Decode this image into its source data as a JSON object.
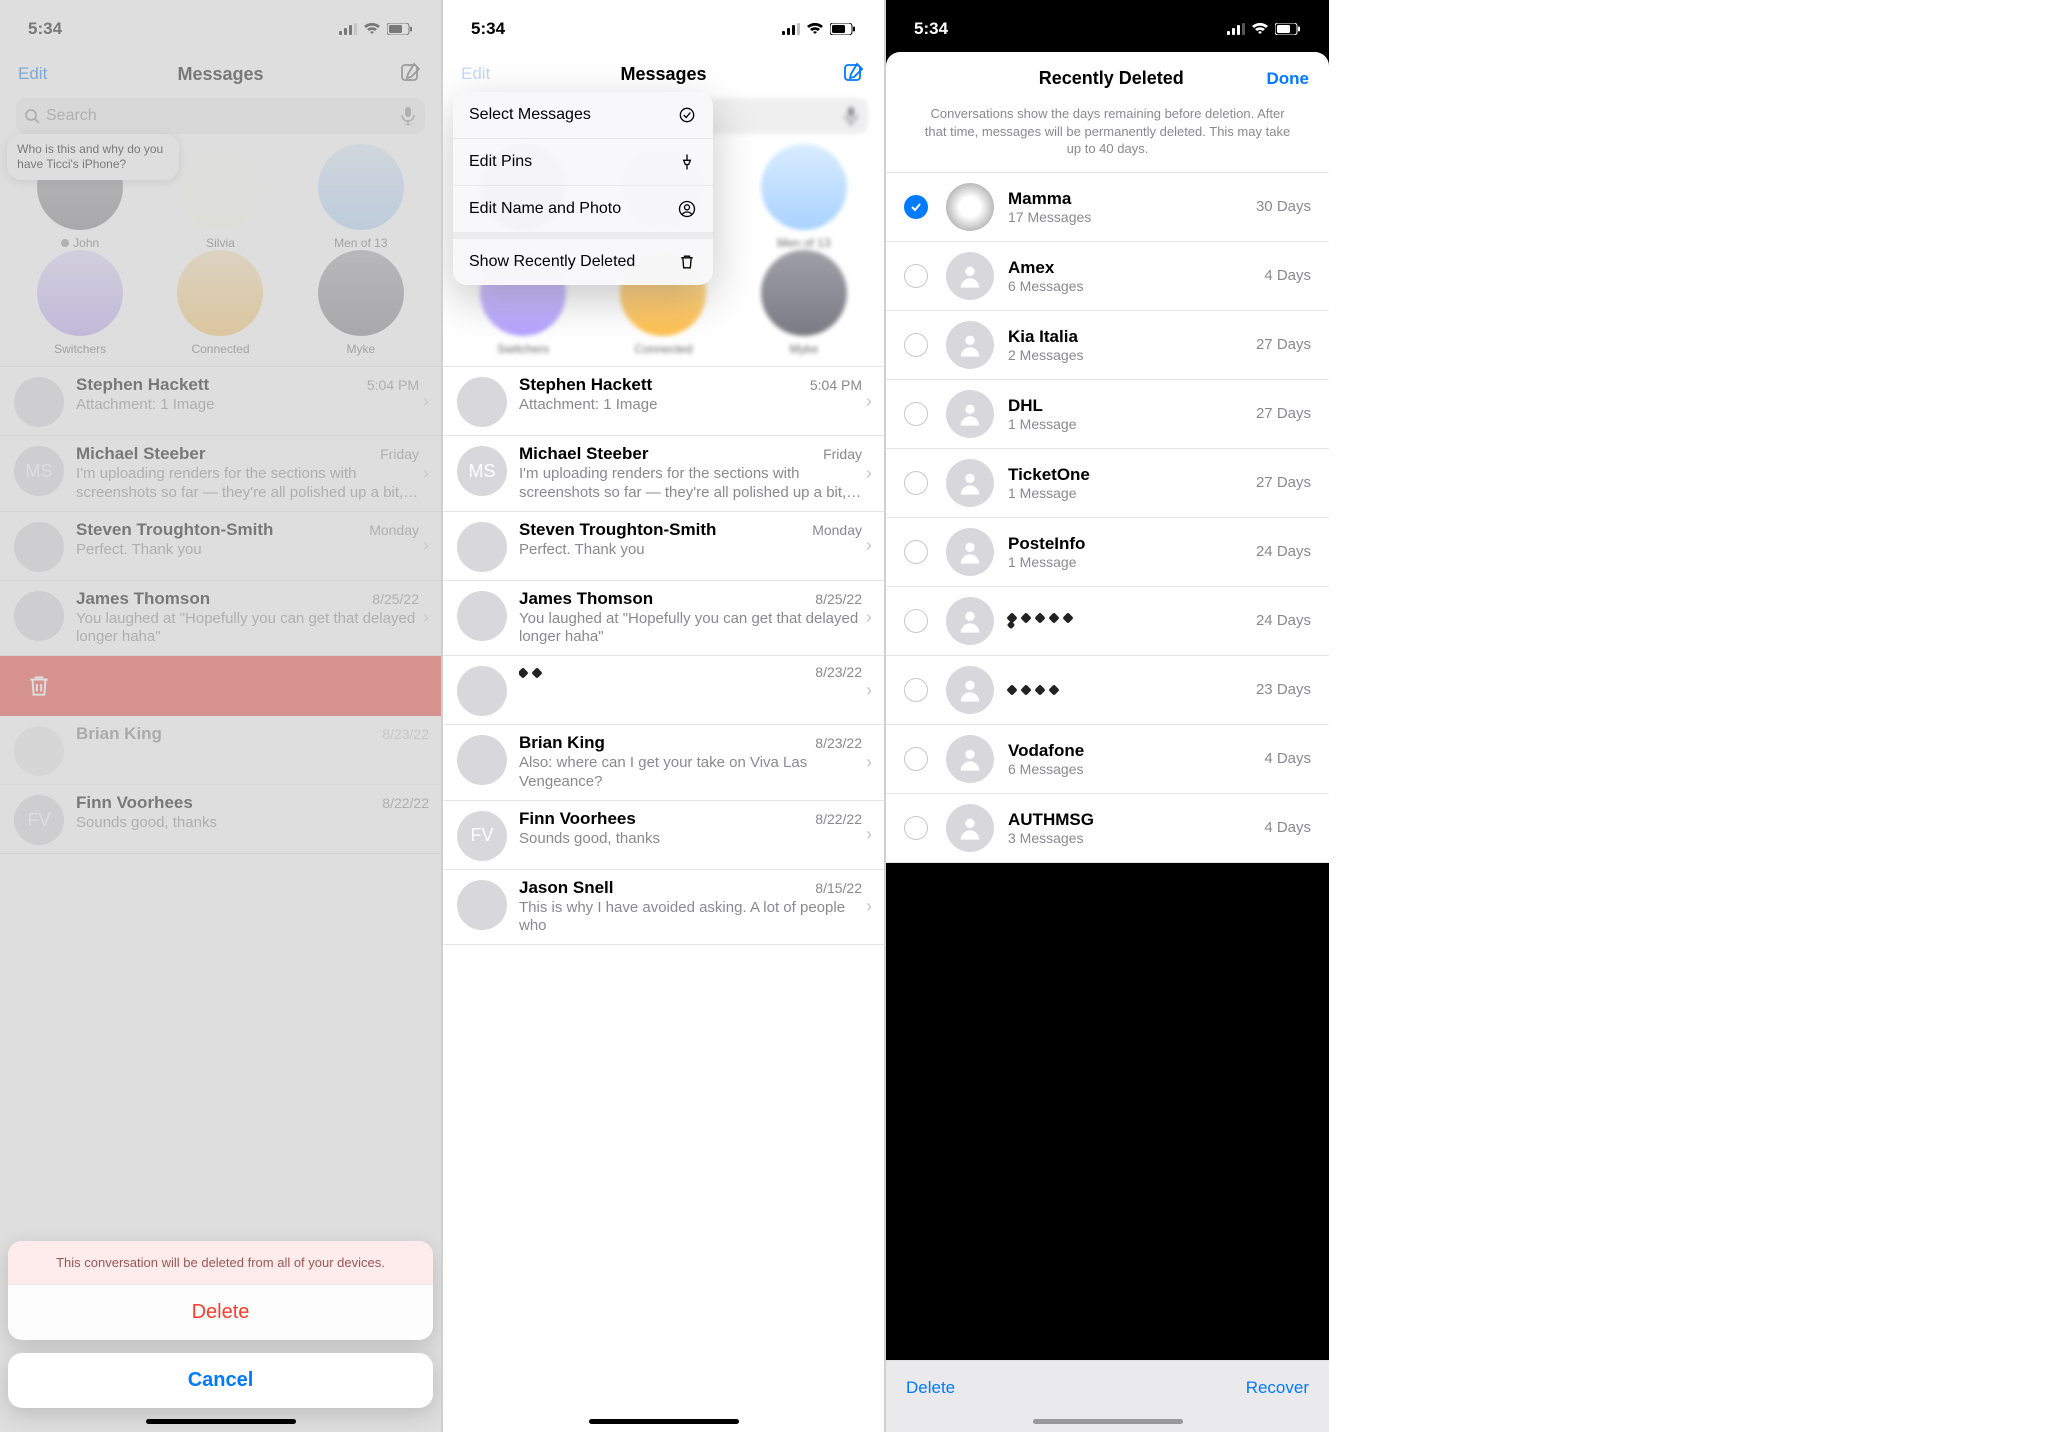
{
  "status": {
    "time": "5:34"
  },
  "panel1": {
    "nav": {
      "edit": "Edit",
      "title": "Messages"
    },
    "search": {
      "placeholder": "Search"
    },
    "pin_bubble": "Who is this and why do you have Ticci's iPhone?",
    "pins": [
      {
        "label": "John",
        "has_dot": true
      },
      {
        "label": "Silvia"
      },
      {
        "label": "Men of 13"
      },
      {
        "label": "Switchers"
      },
      {
        "label": "Connected"
      },
      {
        "label": "Myke"
      }
    ],
    "convs": [
      {
        "name": "Stephen Hackett",
        "time": "5:04 PM",
        "preview": "Attachment: 1 Image",
        "avatar": "av-yellow"
      },
      {
        "name": "Michael Steeber",
        "time": "Friday",
        "preview": "I'm uploading renders for the sections with screenshots so far — they're all polished up a bit, th…",
        "initials": "MS",
        "avatar": "av-ms"
      },
      {
        "name": "Steven Troughton-Smith",
        "time": "Monday",
        "preview": "Perfect. Thank you",
        "avatar": "av-person"
      },
      {
        "name": "James Thomson",
        "time": "8/25/22",
        "preview": "You laughed at \"Hopefully you can get that delayed longer haha\"",
        "avatar": "av-person"
      }
    ],
    "sheet": {
      "msg": "This conversation will be deleted from all of your devices.",
      "delete": "Delete",
      "cancel": "Cancel"
    },
    "below": [
      {
        "name": "Brian King",
        "time": "8/23/22",
        "preview": ""
      },
      {
        "name": "Finn Voorhees",
        "time": "8/22/22",
        "preview": "Sounds good, thanks",
        "initials": "FV"
      }
    ]
  },
  "panel2": {
    "nav": {
      "edit": "Edit",
      "title": "Messages"
    },
    "menu": {
      "select": "Select Messages",
      "pins": "Edit Pins",
      "name": "Edit Name and Photo",
      "deleted": "Show Recently Deleted"
    },
    "pins_labels": {
      "men": "Men of 13",
      "switchers": "Switchers",
      "connected": "Connected",
      "myke": "Myke"
    },
    "convs": [
      {
        "name": "Stephen Hackett",
        "time": "5:04 PM",
        "preview": "Attachment: 1 Image",
        "avatar": "av-yellow"
      },
      {
        "name": "Michael Steeber",
        "time": "Friday",
        "preview": "I'm uploading renders for the sections with screenshots so far — they're all polished up a bit, th…",
        "initials": "MS",
        "avatar": "av-ms"
      },
      {
        "name": "Steven Troughton-Smith",
        "time": "Monday",
        "preview": "Perfect. Thank you",
        "avatar": "av-person"
      },
      {
        "name": "James Thomson",
        "time": "8/25/22",
        "preview": "You laughed at \"Hopefully you can get that delayed longer haha\"",
        "avatar": "av-person"
      },
      {
        "name": "",
        "time": "8/23/22",
        "preview": "",
        "avatar": "av-blue",
        "masked": true
      },
      {
        "name": "Brian King",
        "time": "8/23/22",
        "preview": "Also: where can I get your take on Viva Las Vengeance?",
        "avatar": "av-person"
      },
      {
        "name": "Finn Voorhees",
        "time": "8/22/22",
        "preview": "Sounds good, thanks",
        "initials": "FV",
        "avatar": "av-ms"
      },
      {
        "name": "Jason Snell",
        "time": "8/15/22",
        "preview": "This is why I have avoided asking. A lot of people who",
        "avatar": "av-person"
      }
    ]
  },
  "panel3": {
    "title": "Recently Deleted",
    "done": "Done",
    "note": "Conversations show the days remaining before deletion. After that time, messages will be permanently deleted. This may take up to 40 days.",
    "items": [
      {
        "name": "Mamma",
        "sub": "17 Messages",
        "days": "30 Days",
        "checked": true,
        "avatar": "photo"
      },
      {
        "name": "Amex",
        "sub": "6 Messages",
        "days": "4 Days"
      },
      {
        "name": "Kia Italia",
        "sub": "2 Messages",
        "days": "27 Days"
      },
      {
        "name": "DHL",
        "sub": "1 Message",
        "days": "27 Days"
      },
      {
        "name": "TicketOne",
        "sub": "1 Message",
        "days": "27 Days"
      },
      {
        "name": "PosteInfo",
        "sub": "1 Message",
        "days": "24 Days"
      },
      {
        "name": "",
        "sub": "",
        "days": "24 Days",
        "masked": true
      },
      {
        "name": "",
        "sub": "",
        "days": "23 Days",
        "masked": true
      },
      {
        "name": "Vodafone",
        "sub": "6 Messages",
        "days": "4 Days"
      },
      {
        "name": "AUTHMSG",
        "sub": "3 Messages",
        "days": "4 Days"
      }
    ],
    "toolbar": {
      "delete": "Delete",
      "recover": "Recover"
    }
  }
}
